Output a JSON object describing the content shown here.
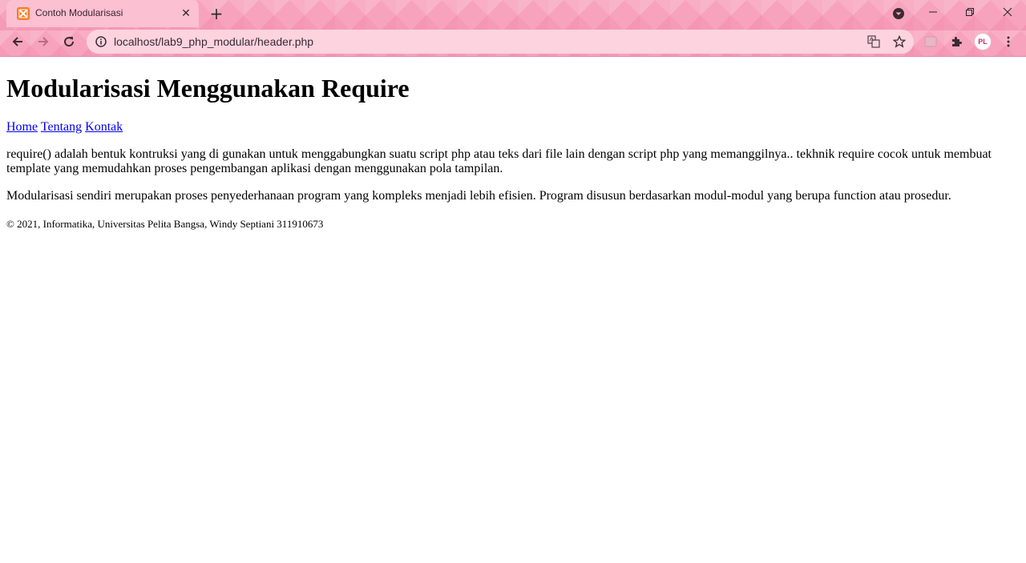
{
  "browser": {
    "tab_title": "Contoh Modularisasi",
    "url": "localhost/lab9_php_modular/header.php",
    "avatar_text": "PL"
  },
  "page": {
    "heading": "Modularisasi Menggunakan Require",
    "nav": [
      "Home",
      "Tentang",
      "Kontak"
    ],
    "paragraphs": [
      "require() adalah bentuk kontruksi yang di gunakan untuk menggabungkan suatu script php atau teks dari file lain dengan script php yang memanggilnya.. tekhnik require cocok untuk membuat template yang memudahkan proses pengembangan aplikasi dengan menggunakan pola tampilan.",
      "Modularisasi sendiri merupakan proses penyederhanaan program yang kompleks menjadi lebih efisien. Program disusun berdasarkan modul-modul yang berupa function atau prosedur."
    ],
    "footer": "© 2021, Informatika, Universitas Pelita Bangsa, Windy Septiani 311910673"
  },
  "colors": {
    "chrome_bg": "#f7a3bd",
    "tab_bg": "#fbc0d2",
    "omnibox_bg": "#fdd3e0",
    "link": "#0000ee"
  }
}
